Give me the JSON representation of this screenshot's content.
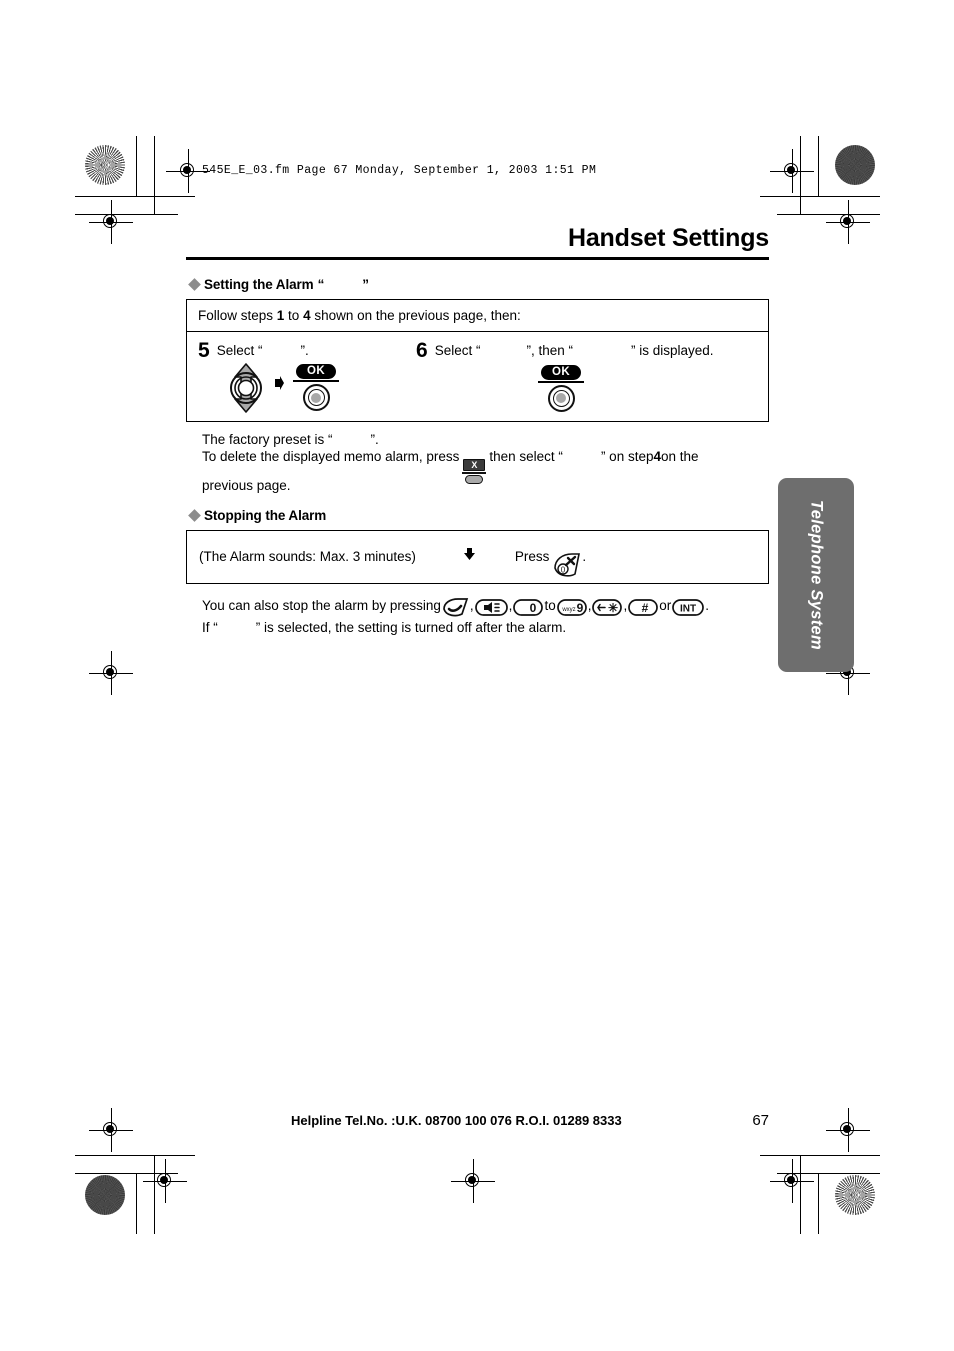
{
  "document": {
    "filestamp": "545E_E_03.fm  Page 67  Monday, September 1, 2003  1:51 PM",
    "page_title": "Handset Settings",
    "page_number": "67",
    "helpline": "Helpline Tel.No. :U.K. 08700 100 076  R.O.I. 01289 8333",
    "side_tab": "Telephone System"
  },
  "section_alarm": {
    "heading_prefix": "Setting the Alarm",
    "heading_quote_open": "“",
    "heading_quote_close": "”",
    "intro": {
      "part1": "Follow steps ",
      "step_a": "1",
      "part2": " to ",
      "step_b": "4",
      "part3": " shown on the previous page, then:"
    },
    "steps": [
      {
        "number": "5",
        "text_before": "Select “",
        "text_after": "”.",
        "icons": [
          "navigator-joystick-icon",
          "right-arrow-icon",
          "ok-softkey-icon"
        ]
      },
      {
        "number": "6",
        "text_before": "Select “",
        "text_middle": "”, then “",
        "text_after": "” is displayed.",
        "icons": [
          "ok-softkey-icon"
        ]
      }
    ],
    "notes": {
      "line1_before": "The factory preset is “",
      "line1_after": "”.",
      "line2_before": "To delete the displayed memo alarm, press ",
      "line2_middle": " then select “",
      "line2_after": "” on step ",
      "line2_step": "4",
      "line2_end": " on the",
      "line3": "previous page."
    }
  },
  "section_stopping": {
    "heading": "Stopping the Alarm",
    "box": {
      "condition": "(The Alarm sounds: Max. 3 minutes)",
      "arrow": "↓",
      "press_label": "Press",
      "press_key": "power-off-key-icon",
      "period": "."
    },
    "note": {
      "line1_before": "You can also stop the alarm by pressing ",
      "sep1": ", ",
      "sep2": ", ",
      "to_label": " to ",
      "sep3": ", ",
      "sep4": ", ",
      "or_label": " or ",
      "period": " .",
      "line2_before": "If “",
      "line2_after": "” is selected, the setting is turned off after the alarm."
    },
    "keys": [
      {
        "name": "talk-key-icon",
        "label": ""
      },
      {
        "name": "speakerphone-key-icon",
        "label": ""
      },
      {
        "name": "key-0",
        "label": "0"
      },
      {
        "name": "key-9-wxyz",
        "label": "9",
        "sub": "wxyz"
      },
      {
        "name": "key-star",
        "label": "∗"
      },
      {
        "name": "key-hash",
        "label": "#"
      },
      {
        "name": "key-int",
        "label": "INT"
      }
    ]
  },
  "softkeys": {
    "ok_label": "OK",
    "clear_label": "X"
  }
}
